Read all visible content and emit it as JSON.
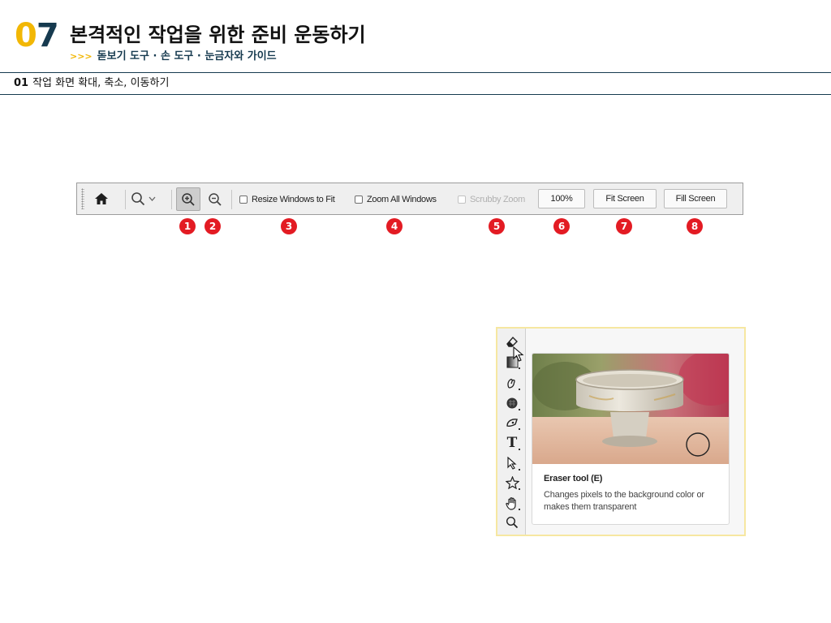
{
  "chapter": {
    "number": "07",
    "title": "본격적인 작업을 위한 준비 운동하기",
    "subtitle_prefix": ">>>",
    "subtitle": "돋보기 도구 · 손 도구 · 눈금자와 가이드"
  },
  "section": {
    "number": "01",
    "title": "작업 화면 확대, 축소, 이동하기"
  },
  "options_bar": {
    "home_icon": "home-icon",
    "preset_icon": "zoom-tool-icon",
    "zoom_in_icon": "zoom-in-icon",
    "zoom_out_icon": "zoom-out-icon",
    "resize_windows_label": "Resize Windows to Fit",
    "zoom_all_label": "Zoom All Windows",
    "scrubby_zoom_label": "Scrubby Zoom",
    "zoom_level": "100%",
    "fit_screen_label": "Fit Screen",
    "fill_screen_label": "Fill Screen"
  },
  "callouts": [
    "1",
    "2",
    "3",
    "4",
    "5",
    "6",
    "7",
    "8"
  ],
  "colors": {
    "accent_yellow": "#f2b705",
    "navy": "#163a4f",
    "callout_red": "#e31b23"
  },
  "tool_panel": {
    "tools": [
      "eraser-icon",
      "gradient-icon",
      "smudge-icon",
      "dodge-icon",
      "pen-icon",
      "type-icon",
      "path-selection-icon",
      "custom-shape-icon",
      "hand-icon",
      "zoom-icon"
    ],
    "type_tool_glyph": "T",
    "tooltip": {
      "title": "Eraser tool (E)",
      "description": "Changes pixels to the background color or makes them transparent"
    }
  }
}
